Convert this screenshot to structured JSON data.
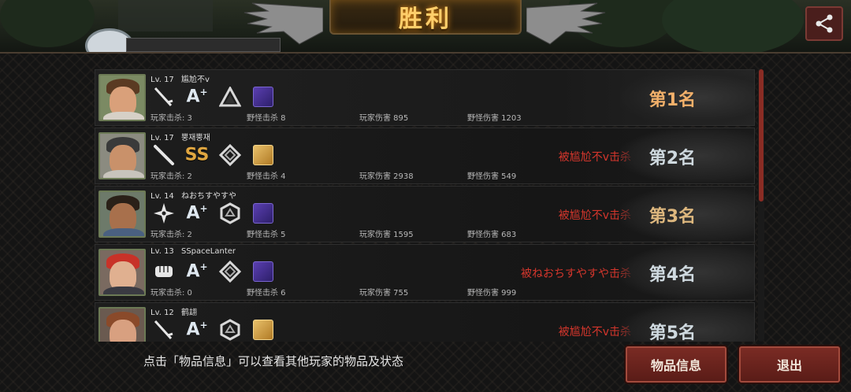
{
  "header": {
    "title": "胜利"
  },
  "players": [
    {
      "level": "Lv. 17",
      "name": "尴尬不v",
      "weapon_icon": "katana-icon",
      "grade": "A",
      "grade_suffix": "+",
      "emblem_icon": "triangle-emblem-icon",
      "pet_icon": "purple-beast-icon",
      "kills_label": "玩家击杀: 3",
      "monster_kills_label": "野怪击杀 8",
      "player_damage_label": "玩家伤害 895",
      "monster_damage_label": "野怪伤害 1203",
      "killed_by": "",
      "rank": "第1名"
    },
    {
      "level": "Lv. 17",
      "name": "뿡재뿡재",
      "weapon_icon": "bat-icon",
      "grade": "SS",
      "grade_suffix": "",
      "emblem_icon": "diamond-emblem-icon",
      "pet_icon": "gold-beast-icon",
      "kills_label": "玩家击杀: 2",
      "monster_kills_label": "野怪击杀 4",
      "player_damage_label": "玩家伤害 2938",
      "monster_damage_label": "野怪伤害 549",
      "killed_by": "被尴尬不v击杀",
      "rank": "第2名"
    },
    {
      "level": "Lv. 14",
      "name": "ねおちすやすや",
      "weapon_icon": "shuriken-icon",
      "grade": "A",
      "grade_suffix": "+",
      "emblem_icon": "hexagon-emblem-icon",
      "pet_icon": "purple-beast-icon",
      "kills_label": "玩家击杀: 2",
      "monster_kills_label": "野怪击杀 5",
      "player_damage_label": "玩家伤害 1595",
      "monster_damage_label": "野怪伤害 683",
      "killed_by": "被尴尬不v击杀",
      "rank": "第3名"
    },
    {
      "level": "Lv. 13",
      "name": "SSpaceLanter",
      "weapon_icon": "fist-icon",
      "grade": "A",
      "grade_suffix": "+",
      "emblem_icon": "diamond-emblem-icon",
      "pet_icon": "purple-beast-icon",
      "kills_label": "玩家击杀: 0",
      "monster_kills_label": "野怪击杀 6",
      "player_damage_label": "玩家伤害 755",
      "monster_damage_label": "野怪伤害 999",
      "killed_by": "被ねおちすやすや击杀",
      "rank": "第4名"
    },
    {
      "level": "Lv. 12",
      "name": "鹤翃",
      "weapon_icon": "katana-icon",
      "grade": "A",
      "grade_suffix": "+",
      "emblem_icon": "hexagon-emblem-icon",
      "pet_icon": "gold-beast-icon",
      "kills_label": "",
      "monster_kills_label": "",
      "player_damage_label": "",
      "monster_damage_label": "",
      "killed_by": "被尴尬不v击杀",
      "rank": "第5名"
    }
  ],
  "footer": {
    "hint": "点击「物品信息」可以查看其他玩家的物品及状态",
    "items_button": "物品信息",
    "exit_button": "退出"
  },
  "colors": {
    "accent_red": "#d4362c",
    "gold": "#ffce6a",
    "button_bg": "#6a241e"
  }
}
